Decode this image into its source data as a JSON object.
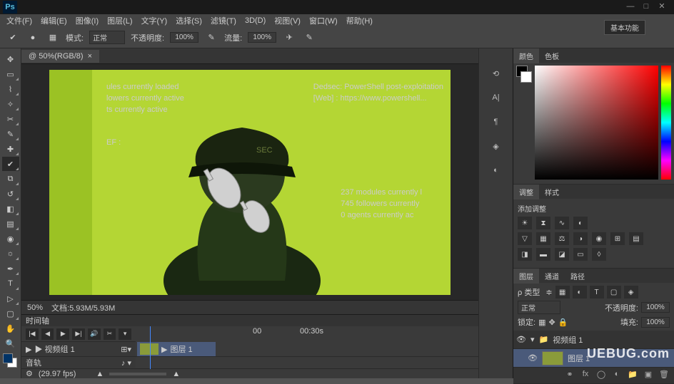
{
  "titlebar": {
    "logo": "Ps"
  },
  "menu": [
    "文件(F)",
    "编辑(E)",
    "图像(I)",
    "图层(L)",
    "文字(Y)",
    "选择(S)",
    "滤镜(T)",
    "3D(D)",
    "视图(V)",
    "窗口(W)",
    "帮助(H)"
  ],
  "window_controls": {
    "min": "—",
    "max": "□",
    "close": "✕"
  },
  "options": {
    "mode_label": "模式:",
    "mode_value": "正常",
    "opacity_label": "不透明度:",
    "opacity_value": "100%",
    "flow_label": "流量:",
    "flow_value": "100%"
  },
  "essentials": "基本功能",
  "doc_tab": {
    "name": "@ 50%(RGB/8)",
    "close": "×"
  },
  "canvas_text": {
    "left_l1": "ules currently loaded",
    "left_l2": "lowers currently active",
    "left_l3": "ts currently active",
    "left_l4": "EF :",
    "hat": "SEC",
    "right_l1": "Dedsec: PowerShell post-exploitation",
    "right_l2": "[Web] : https://www.powershell...",
    "r2_l1": "237  modules currently l",
    "r2_l2": "745  followers currently",
    "r2_l3": "0    agents currently ac"
  },
  "status": {
    "zoom": "50%",
    "docinfo": "文档:5.93M/5.93M"
  },
  "timeline": {
    "tab": "时间轴",
    "time0": "00",
    "time30": "00:30s",
    "fps": "(29.97 fps)",
    "track1": "▶ 视频组 1",
    "clip": "图层 1",
    "track2": "音轨"
  },
  "panels": {
    "color_tab": "颜色",
    "swatch_tab": "色板",
    "adjust_tab": "调整",
    "styles_tab": "样式",
    "adjust_title": "添加调整",
    "layers_tab": "图层",
    "channels_tab": "通道",
    "paths_tab": "路径",
    "kind_label": "ρ 类型",
    "blend_label": "正常",
    "opacity_label": "不透明度:",
    "opacity_val": "100%",
    "lock_label": "锁定:",
    "fill_label": "填充:",
    "fill_val": "100%",
    "layer1": "视频组 1",
    "layer2": "图层 1"
  },
  "watermark": "UEBUG.com"
}
